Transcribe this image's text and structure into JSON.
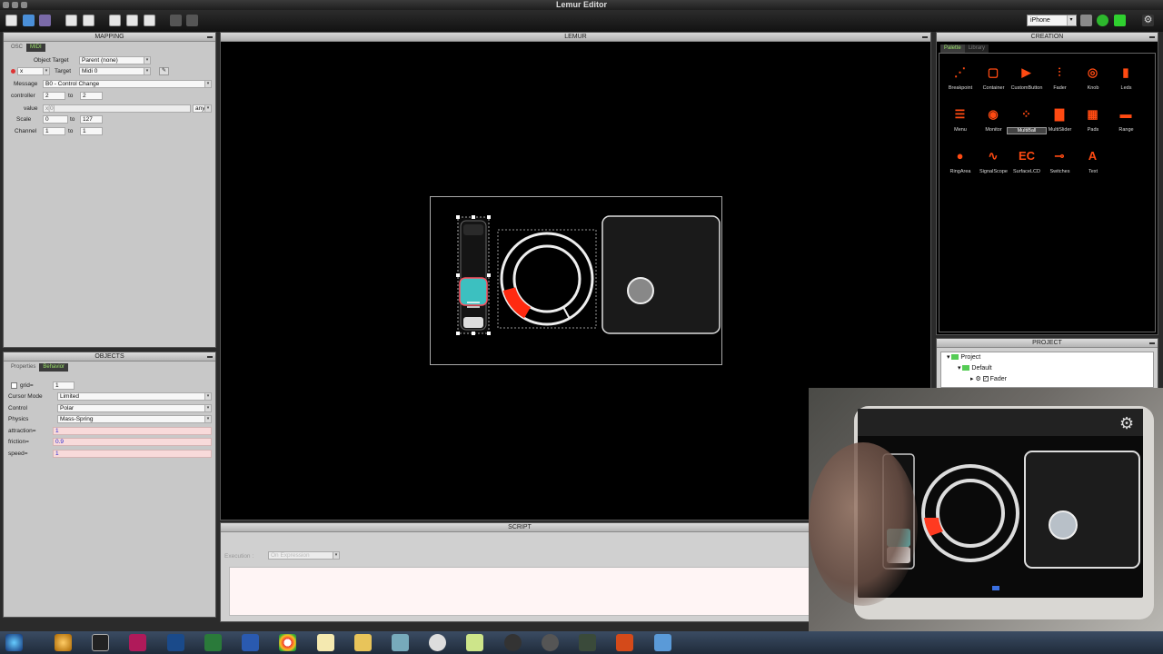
{
  "app": {
    "title": "Lemur Editor"
  },
  "toolbar": {
    "device": "iPhone"
  },
  "mapping": {
    "title": "MAPPING",
    "tabs": [
      "OSC",
      "MIDI"
    ],
    "object_target_label": "Object Target",
    "object_target_value": "Parent (none)",
    "var_name": "x",
    "target_label": "Target",
    "target_value": "Midi 0",
    "message_label": "Message",
    "message_value": "B0 - Control Change",
    "controller_label": "controller",
    "controller_from": "2",
    "controller_to_label": "to",
    "controller_to": "2",
    "value_label": "value",
    "value_expr": "x[0]",
    "value_mode": "any",
    "scale_label": "Scale",
    "scale_from": "0",
    "scale_to_label": "to",
    "scale_to": "127",
    "channel_label": "Channel",
    "channel_from": "1",
    "channel_to_label": "to",
    "channel_to": "1"
  },
  "objects": {
    "title": "OBJECTS",
    "tabs": [
      "Properties",
      "Behavior"
    ],
    "grid_label": "grid=",
    "grid_value": "1",
    "cursor_mode_label": "Cursor Mode",
    "cursor_mode_value": "Limited",
    "control_label": "Control",
    "control_value": "Polar",
    "physics_label": "Physics",
    "physics_value": "Mass-Spring",
    "attraction_label": "attraction=",
    "attraction_value": "1",
    "friction_label": "friction=",
    "friction_value": "0.9",
    "speed_label": "speed=",
    "speed_value": "1"
  },
  "lemur": {
    "title": "LEMUR"
  },
  "script": {
    "title": "SCRIPT",
    "execution_label": "Execution :",
    "execution_value": "On Expression"
  },
  "creation": {
    "title": "CREATION",
    "tabs": [
      "Palette",
      "Library"
    ],
    "items": [
      {
        "label": "Breakpoint",
        "glyph": "⋰"
      },
      {
        "label": "Container",
        "glyph": "▢"
      },
      {
        "label": "CustomButton",
        "glyph": "▶"
      },
      {
        "label": "Fader",
        "glyph": "⫶"
      },
      {
        "label": "Knob",
        "glyph": "◎"
      },
      {
        "label": "Leds",
        "glyph": "▮"
      },
      {
        "label": "Menu",
        "glyph": "☰"
      },
      {
        "label": "Monitor",
        "glyph": "◉"
      },
      {
        "label": "MultiBall",
        "glyph": "⁘"
      },
      {
        "label": "MultiSlider",
        "glyph": "▇"
      },
      {
        "label": "Pads",
        "glyph": "▦"
      },
      {
        "label": "Range",
        "glyph": "▬"
      },
      {
        "label": "RingArea",
        "glyph": "●"
      },
      {
        "label": "SignalScope",
        "glyph": "∿"
      },
      {
        "label": "SurfaceLCD",
        "glyph": "EC"
      },
      {
        "label": "Switches",
        "glyph": "⊸"
      },
      {
        "label": "Text",
        "glyph": "A"
      }
    ],
    "selected": "MultiBall"
  },
  "project": {
    "title": "PROJECT",
    "root": "Project",
    "child": "Default",
    "leaf": "Fader"
  },
  "colors": {
    "accent": "#ff4a12",
    "tab_active_text": "#9be26a",
    "fader_teal": "#3cc0c0",
    "knob_red": "#ff2a10"
  },
  "widgets": {
    "fader_level": 0.3,
    "knob_value": 0.15
  }
}
